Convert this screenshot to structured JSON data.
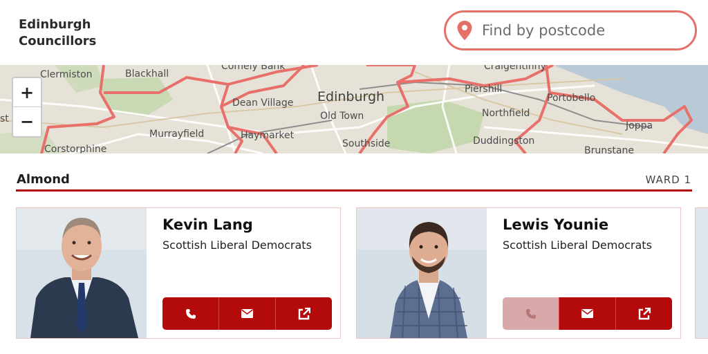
{
  "header": {
    "title_line1": "Edinburgh",
    "title_line2": "Councillors",
    "search": {
      "placeholder": "Find by postcode",
      "value": ""
    }
  },
  "map": {
    "labels": {
      "clermiston": "Clermiston",
      "blackhall": "Blackhall",
      "comely_bank": "Comely Bank",
      "craigentinny": "Craigentinny",
      "edinburgh": "Edinburgh",
      "old_town": "Old Town",
      "dean_village": "Dean Village",
      "murrayfield": "Murrayfield",
      "haymarket": "Haymarket",
      "piershill": "Piershill",
      "portobello": "Portobello",
      "northfield": "Northfield",
      "joppa": "Joppa",
      "southside": "Southside",
      "duddingston": "Duddingston",
      "brunstane": "Brunstane",
      "corstorphine": "Corstorphine",
      "edge_st": "st"
    },
    "zoom_in_label": "+",
    "zoom_out_label": "−"
  },
  "ward": {
    "name": "Almond",
    "number_label": "WARD 1"
  },
  "councillors": [
    {
      "name": "Kevin Lang",
      "party": "Scottish Liberal Democrats",
      "phone_enabled": true,
      "actions": {
        "phone": "phone-icon",
        "email": "email-icon",
        "website": "external-link-icon"
      }
    },
    {
      "name": "Lewis Younie",
      "party": "Scottish Liberal Democrats",
      "phone_enabled": false,
      "actions": {
        "phone": "phone-icon",
        "email": "email-icon",
        "website": "external-link-icon"
      }
    }
  ],
  "colors": {
    "accent": "#b30b0b",
    "search_border": "#e47068",
    "ward_border": "#e8706a",
    "disabled_button": "#d8a9a9"
  }
}
